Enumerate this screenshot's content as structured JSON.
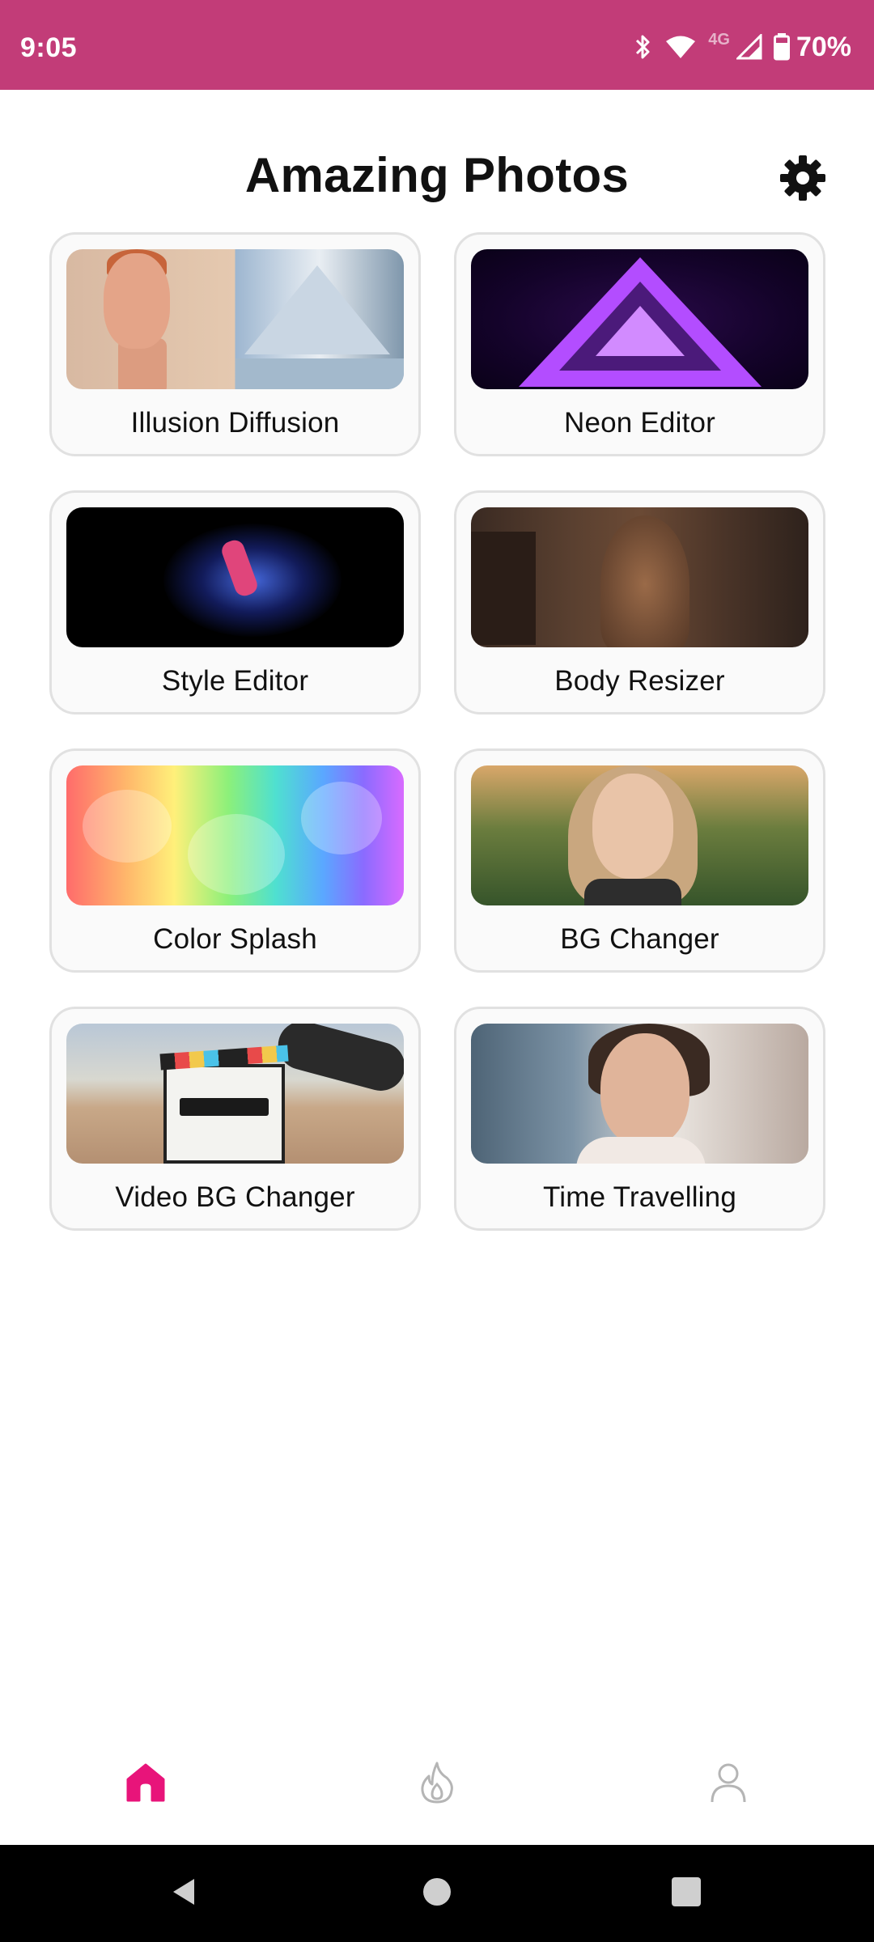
{
  "status_bar": {
    "time": "9:05",
    "network": "4G",
    "battery": "70%",
    "icons": [
      "bluetooth-icon",
      "wifi-icon",
      "signal-icon",
      "battery-icon"
    ],
    "background_color": "#c23c78"
  },
  "header": {
    "title": "Amazing Photos",
    "settings_icon": "gear-icon"
  },
  "cards": [
    {
      "label": "Illusion Diffusion"
    },
    {
      "label": "Neon Editor"
    },
    {
      "label": "Style Editor"
    },
    {
      "label": "Body Resizer"
    },
    {
      "label": "Color Splash"
    },
    {
      "label": "BG Changer"
    },
    {
      "label": "Video BG Changer"
    },
    {
      "label": "Time Travelling"
    }
  ],
  "bottom_nav": {
    "items": [
      {
        "icon": "home-icon",
        "active": true
      },
      {
        "icon": "flame-icon",
        "active": false
      },
      {
        "icon": "profile-icon",
        "active": false
      }
    ],
    "active_color": "#e8147a",
    "inactive_color": "#b5b5b5"
  },
  "system_nav": {
    "buttons": [
      "back-icon",
      "home-circle-icon",
      "recents-icon"
    ]
  }
}
